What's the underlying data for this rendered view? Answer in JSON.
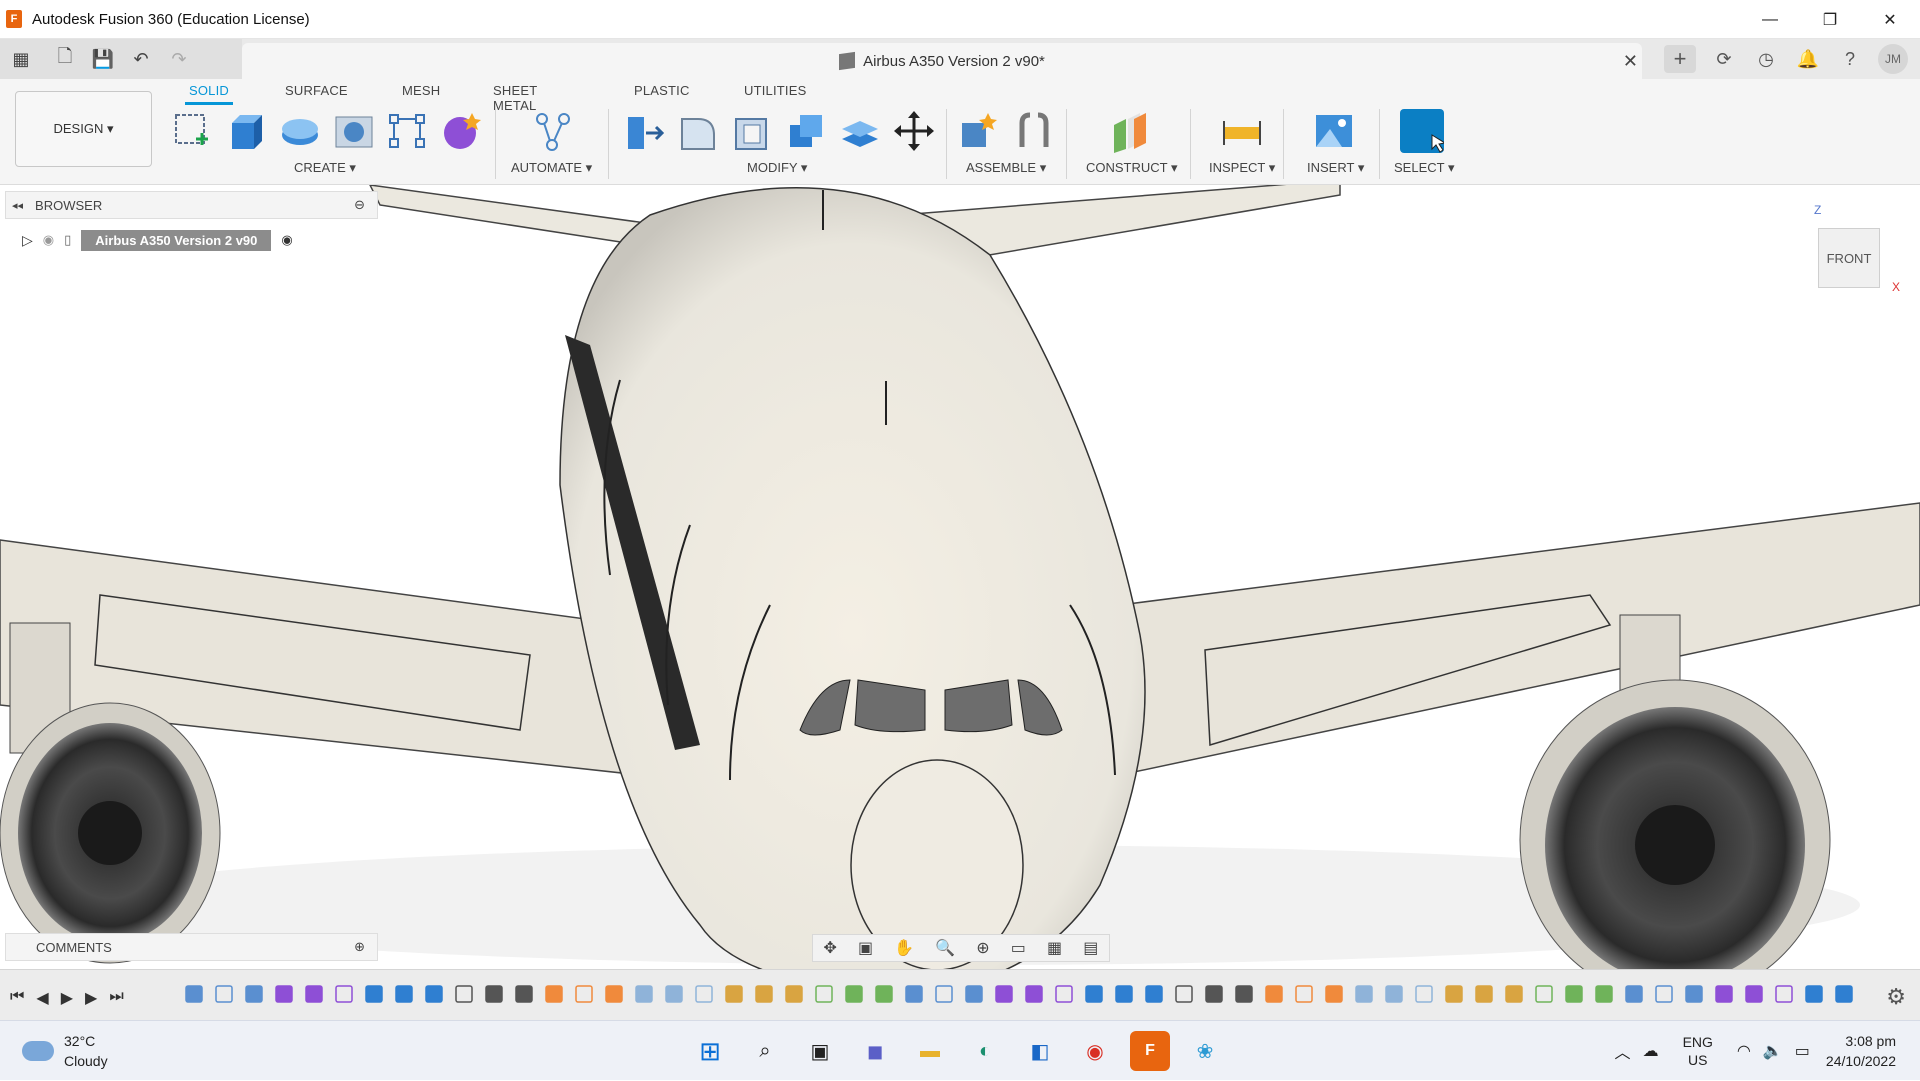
{
  "window": {
    "title": "Autodesk Fusion 360 (Education License)",
    "minimize": "—",
    "restore": "❐",
    "close": "✕"
  },
  "document_tab": {
    "title": "Airbus A350 Version 2 v90*",
    "close": "✕"
  },
  "user": {
    "initials": "JM"
  },
  "ribbon": {
    "workspace": "DESIGN ▾",
    "tabs": [
      "SOLID",
      "SURFACE",
      "MESH",
      "SHEET METAL",
      "PLASTIC",
      "UTILITIES"
    ],
    "active_tab": "SOLID",
    "groups": {
      "create": "CREATE ▾",
      "automate": "AUTOMATE ▾",
      "modify": "MODIFY ▾",
      "assemble": "ASSEMBLE ▾",
      "construct": "CONSTRUCT ▾",
      "inspect": "INSPECT ▾",
      "insert": "INSERT ▾",
      "select": "SELECT ▾"
    }
  },
  "browser": {
    "header": "BROWSER",
    "root_component": "Airbus A350 Version 2 v90"
  },
  "comments": {
    "header": "COMMENTS"
  },
  "viewcube": {
    "face": "FRONT",
    "axis_z": "Z",
    "axis_x": "X"
  },
  "taskbar": {
    "temperature": "32°C",
    "condition": "Cloudy",
    "language_line1": "ENG",
    "language_line2": "US",
    "time": "3:08 pm",
    "date": "24/10/2022"
  },
  "colors": {
    "accent": "#0696d7",
    "select_tool": "#0b7fc4",
    "fusion_orange": "#e8650f"
  }
}
